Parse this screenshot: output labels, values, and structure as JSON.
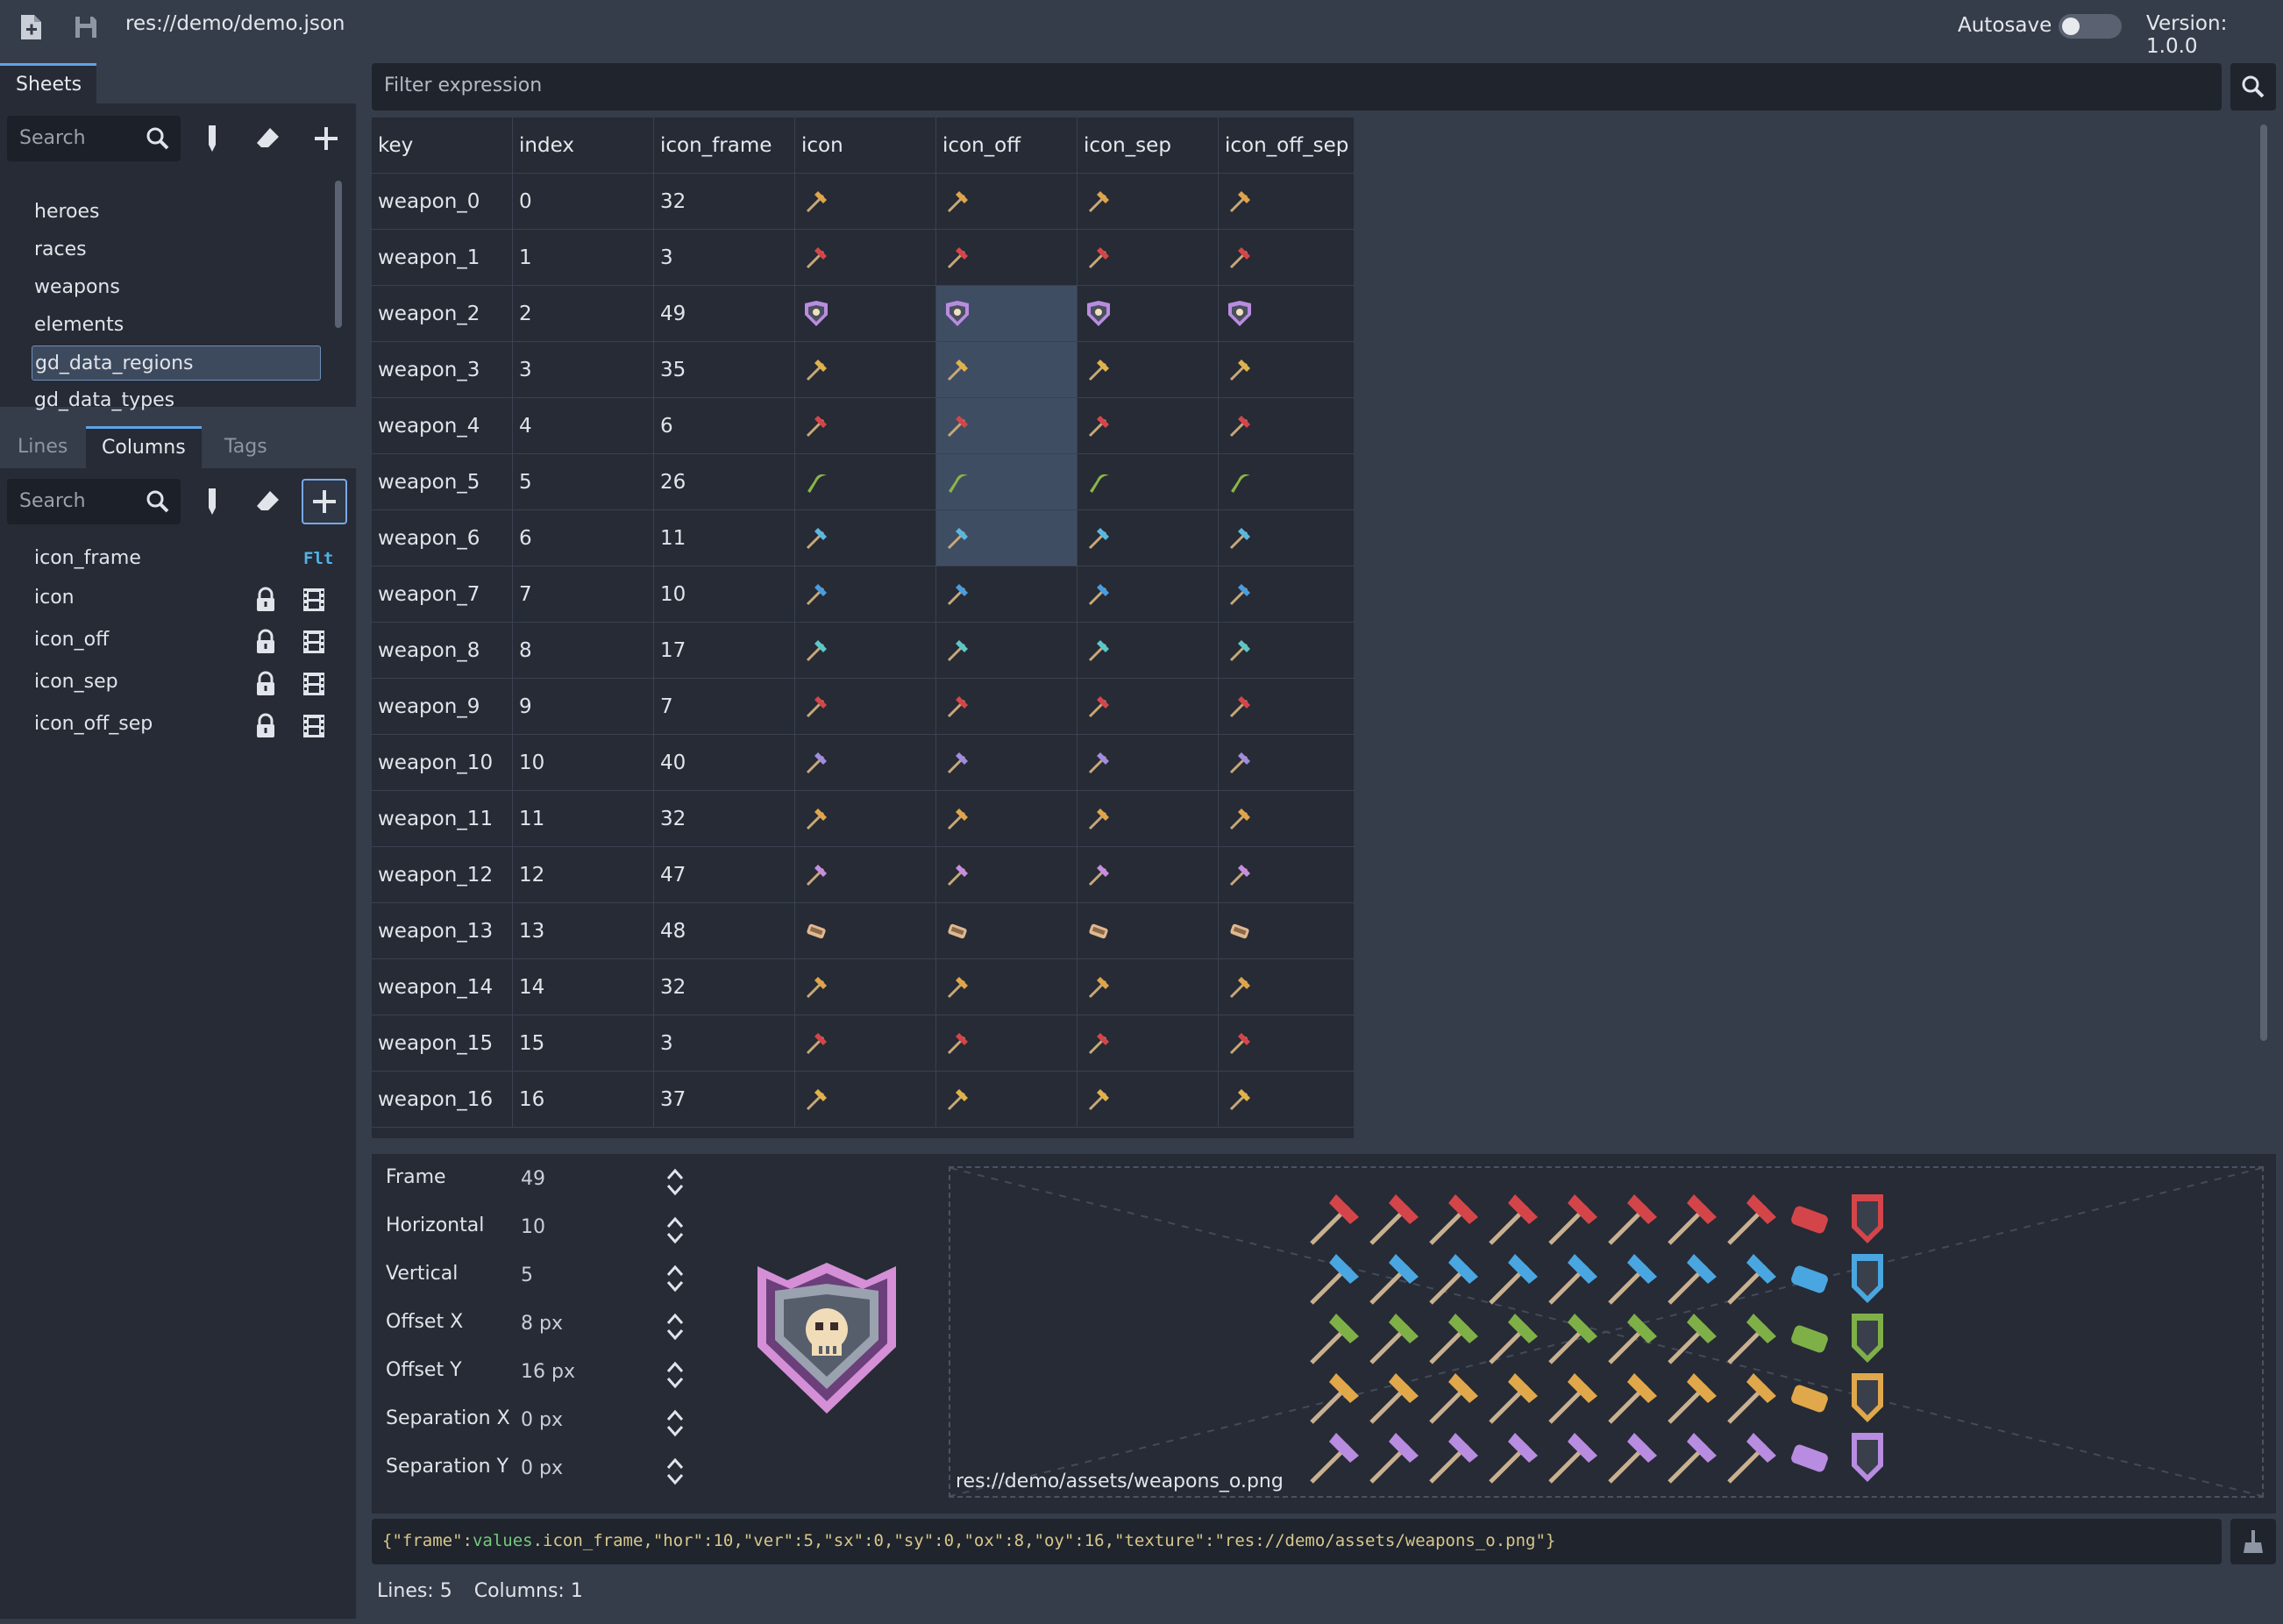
{
  "topbar": {
    "file_path": "res://demo/demo.json",
    "autosave_label": "Autosave",
    "autosave_on": false,
    "version": "Version: 1.0.0"
  },
  "sheets_panel": {
    "tab": "Sheets",
    "search_placeholder": "Search",
    "items": [
      "heroes",
      "races",
      "weapons",
      "elements",
      "gd_data_regions",
      "gd_data_types"
    ],
    "selected": "gd_data_regions"
  },
  "columns_panel": {
    "tabs": [
      "Lines",
      "Columns",
      "Tags"
    ],
    "active_tab": "Columns",
    "search_placeholder": "Search",
    "columns": [
      {
        "name": "icon_frame",
        "badge": "Flt"
      },
      {
        "name": "icon",
        "badge": ""
      },
      {
        "name": "icon_off",
        "badge": ""
      },
      {
        "name": "icon_sep",
        "badge": ""
      },
      {
        "name": "icon_off_sep",
        "badge": ""
      }
    ]
  },
  "filter": {
    "placeholder": "Filter expression"
  },
  "grid": {
    "headers": [
      "key",
      "index",
      "icon_frame",
      "icon",
      "icon_off",
      "icon_sep",
      "icon_off_sep"
    ],
    "rows": [
      {
        "key": "weapon_0",
        "index": "0",
        "icon_frame": "32",
        "icon_color": "#e0a44a",
        "icon_name": "hammer-icon"
      },
      {
        "key": "weapon_1",
        "index": "1",
        "icon_frame": "3",
        "icon_color": "#d4454a",
        "icon_name": "dagger-icon"
      },
      {
        "key": "weapon_2",
        "index": "2",
        "icon_frame": "49",
        "icon_color": "#b98ce0",
        "icon_name": "skull-shield-icon"
      },
      {
        "key": "weapon_3",
        "index": "3",
        "icon_frame": "35",
        "icon_color": "#e0b24a",
        "icon_name": "spear-icon"
      },
      {
        "key": "weapon_4",
        "index": "4",
        "icon_frame": "6",
        "icon_color": "#d4454a",
        "icon_name": "pickaxe-icon"
      },
      {
        "key": "weapon_5",
        "index": "5",
        "icon_frame": "26",
        "icon_color": "#8bb548",
        "icon_name": "sickle-icon"
      },
      {
        "key": "weapon_6",
        "index": "6",
        "icon_frame": "11",
        "icon_color": "#5ab8e0",
        "icon_name": "axe-icon"
      },
      {
        "key": "weapon_7",
        "index": "7",
        "icon_frame": "10",
        "icon_color": "#4a9ce0",
        "icon_name": "sword-icon"
      },
      {
        "key": "weapon_8",
        "index": "8",
        "icon_frame": "17",
        "icon_color": "#5ac8c8",
        "icon_name": "scythe-icon"
      },
      {
        "key": "weapon_9",
        "index": "9",
        "icon_frame": "7",
        "icon_color": "#d4454a",
        "icon_name": "wand-icon"
      },
      {
        "key": "weapon_10",
        "index": "10",
        "icon_frame": "40",
        "icon_color": "#a08ce0",
        "icon_name": "sword-icon"
      },
      {
        "key": "weapon_11",
        "index": "11",
        "icon_frame": "32",
        "icon_color": "#e0a44a",
        "icon_name": "hammer-icon"
      },
      {
        "key": "weapon_12",
        "index": "12",
        "icon_frame": "47",
        "icon_color": "#c88ce0",
        "icon_name": "wand-icon"
      },
      {
        "key": "weapon_13",
        "index": "13",
        "icon_frame": "48",
        "icon_color": "#e0b890",
        "icon_name": "scroll-icon"
      },
      {
        "key": "weapon_14",
        "index": "14",
        "icon_frame": "32",
        "icon_color": "#e0a44a",
        "icon_name": "hammer-icon"
      },
      {
        "key": "weapon_15",
        "index": "15",
        "icon_frame": "3",
        "icon_color": "#d4454a",
        "icon_name": "dagger-icon"
      },
      {
        "key": "weapon_16",
        "index": "16",
        "icon_frame": "37",
        "icon_color": "#e0b24a",
        "icon_name": "spear-icon"
      }
    ],
    "highlighted_column": "icon_off",
    "highlighted_rows": [
      2,
      3,
      4,
      5,
      6
    ]
  },
  "editor": {
    "props": [
      {
        "label": "Frame",
        "value": "49"
      },
      {
        "label": "Horizontal",
        "value": "10"
      },
      {
        "label": "Vertical",
        "value": "5"
      },
      {
        "label": "Offset X",
        "value": "8 px"
      },
      {
        "label": "Offset Y",
        "value": "16 px"
      },
      {
        "label": "Separation X",
        "value": "0 px"
      },
      {
        "label": "Separation Y",
        "value": "0 px"
      }
    ],
    "texture_path": "res://demo/assets/weapons_o.png",
    "atlas_row_colors": [
      "#d4454a",
      "#4aa6e0",
      "#7fb048",
      "#e0a84a",
      "#b88ce0"
    ]
  },
  "json_expr": {
    "prefix": "{\"frame\":",
    "values_kw": "values",
    "suffix": ".icon_frame,\"hor\":10,\"ver\":5,\"sx\":0,\"sy\":0,\"ox\":8,\"oy\":16,\"texture\":\"res://demo/assets/weapons_o.png\"}"
  },
  "status": {
    "lines": "Lines: 5",
    "columns": "Columns: 1"
  }
}
